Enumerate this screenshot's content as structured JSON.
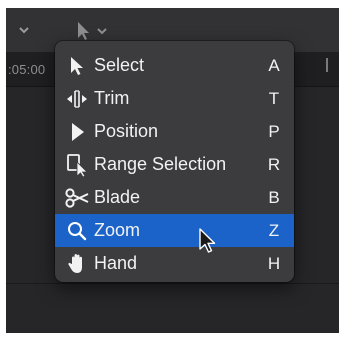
{
  "timeline": {
    "timecode": ":05:00",
    "ruler_mark": "|"
  },
  "tool_menu": {
    "items": [
      {
        "id": "select",
        "label": "Select",
        "shortcut": "A",
        "icon": "arrow-pointer-icon",
        "selected": false
      },
      {
        "id": "trim",
        "label": "Trim",
        "shortcut": "T",
        "icon": "trim-icon",
        "selected": false
      },
      {
        "id": "position",
        "label": "Position",
        "shortcut": "P",
        "icon": "position-arrow-icon",
        "selected": false
      },
      {
        "id": "range-selection",
        "label": "Range Selection",
        "shortcut": "R",
        "icon": "range-selection-icon",
        "selected": false
      },
      {
        "id": "blade",
        "label": "Blade",
        "shortcut": "B",
        "icon": "scissors-icon",
        "selected": false
      },
      {
        "id": "zoom",
        "label": "Zoom",
        "shortcut": "Z",
        "icon": "magnifier-icon",
        "selected": true
      },
      {
        "id": "hand",
        "label": "Hand",
        "shortcut": "H",
        "icon": "hand-icon",
        "selected": false
      }
    ]
  },
  "colors": {
    "menu_background": "#3c3c3f",
    "selection_highlight": "#1b63c9",
    "app_background": "#2a2a2c"
  }
}
